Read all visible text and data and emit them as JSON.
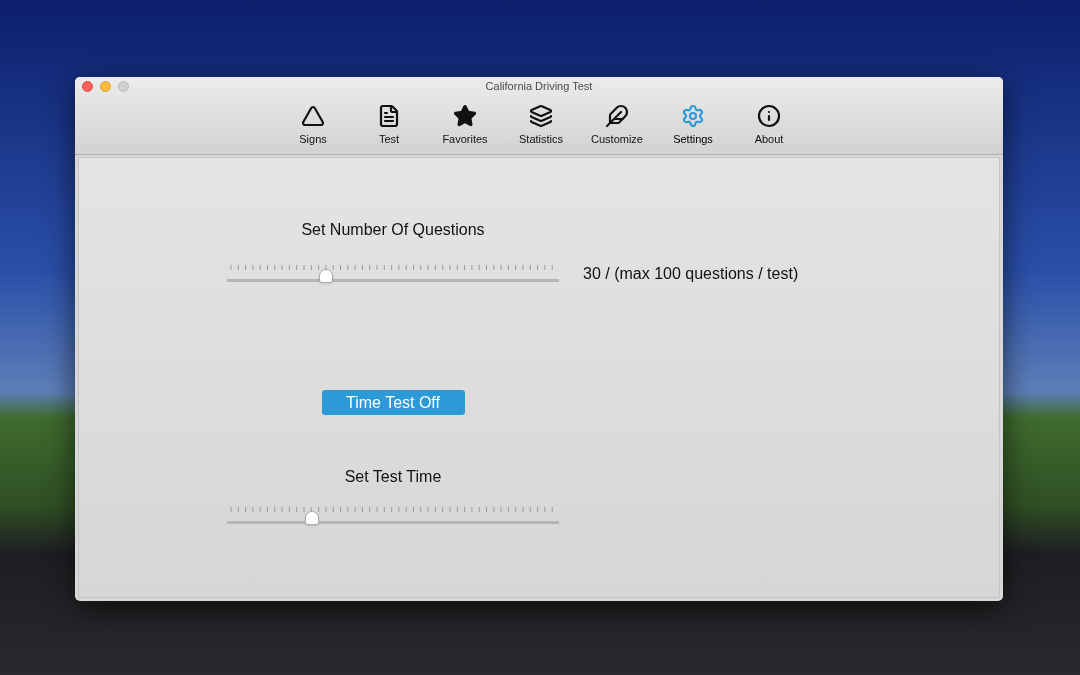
{
  "window": {
    "title": "California Driving Test"
  },
  "toolbar": [
    {
      "kind": "signs",
      "label": "Signs",
      "selected": false
    },
    {
      "kind": "test",
      "label": "Test",
      "selected": false
    },
    {
      "kind": "favorites",
      "label": "Favorites",
      "selected": false
    },
    {
      "kind": "statistics",
      "label": "Statistics",
      "selected": false
    },
    {
      "kind": "customize",
      "label": "Customize",
      "selected": false
    },
    {
      "kind": "settings",
      "label": "Settings",
      "selected": true
    },
    {
      "kind": "about",
      "label": "About",
      "selected": false
    }
  ],
  "questions": {
    "title": "Set Number Of Questions",
    "level": 0.29,
    "reading": "30 / (max 100 questions / test)"
  },
  "time_button": {
    "label": "Time Test Off"
  },
  "time": {
    "title": "Set Test Time",
    "level": 0.245
  }
}
